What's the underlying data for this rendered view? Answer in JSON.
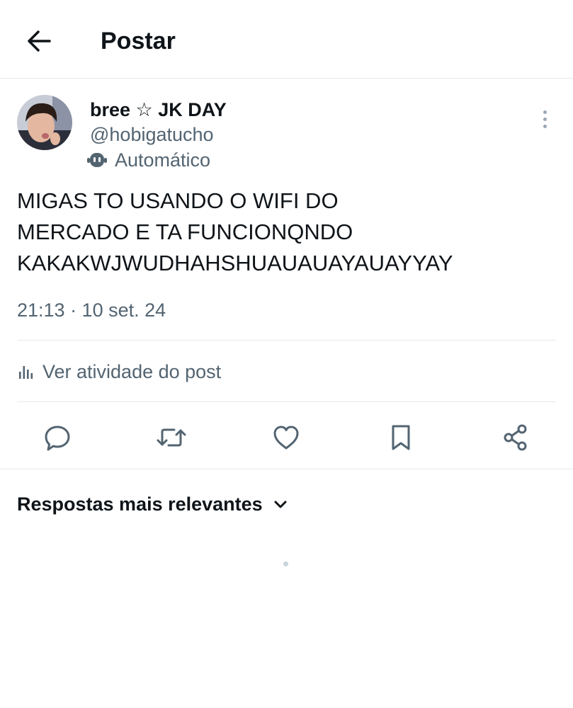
{
  "header": {
    "title": "Postar",
    "back_icon": "arrow-left-icon"
  },
  "post": {
    "author_name": "bree ☆ JK DAY",
    "handle": "@hobigatucho",
    "automated_label": "Automático",
    "text": "MIGAS TO USANDO O WIFI DO\nMERCADO E TA FUNCIONQNDO\nKAKAKWJWUDHAHSHUAUAUAYAUAYYAY",
    "timestamp": "21:13 · 10 set. 24"
  },
  "activity": {
    "label": "Ver atividade do post"
  },
  "actions": [
    {
      "name": "reply",
      "icon": "reply-icon"
    },
    {
      "name": "repost",
      "icon": "repost-icon"
    },
    {
      "name": "like",
      "icon": "heart-icon"
    },
    {
      "name": "bookmark",
      "icon": "bookmark-icon"
    },
    {
      "name": "share",
      "icon": "share-icon"
    }
  ],
  "replies": {
    "sort_label": "Respostas mais relevantes"
  },
  "colors": {
    "text": "#0f1419",
    "secondary": "#536471",
    "divider": "#e6e9ec"
  }
}
